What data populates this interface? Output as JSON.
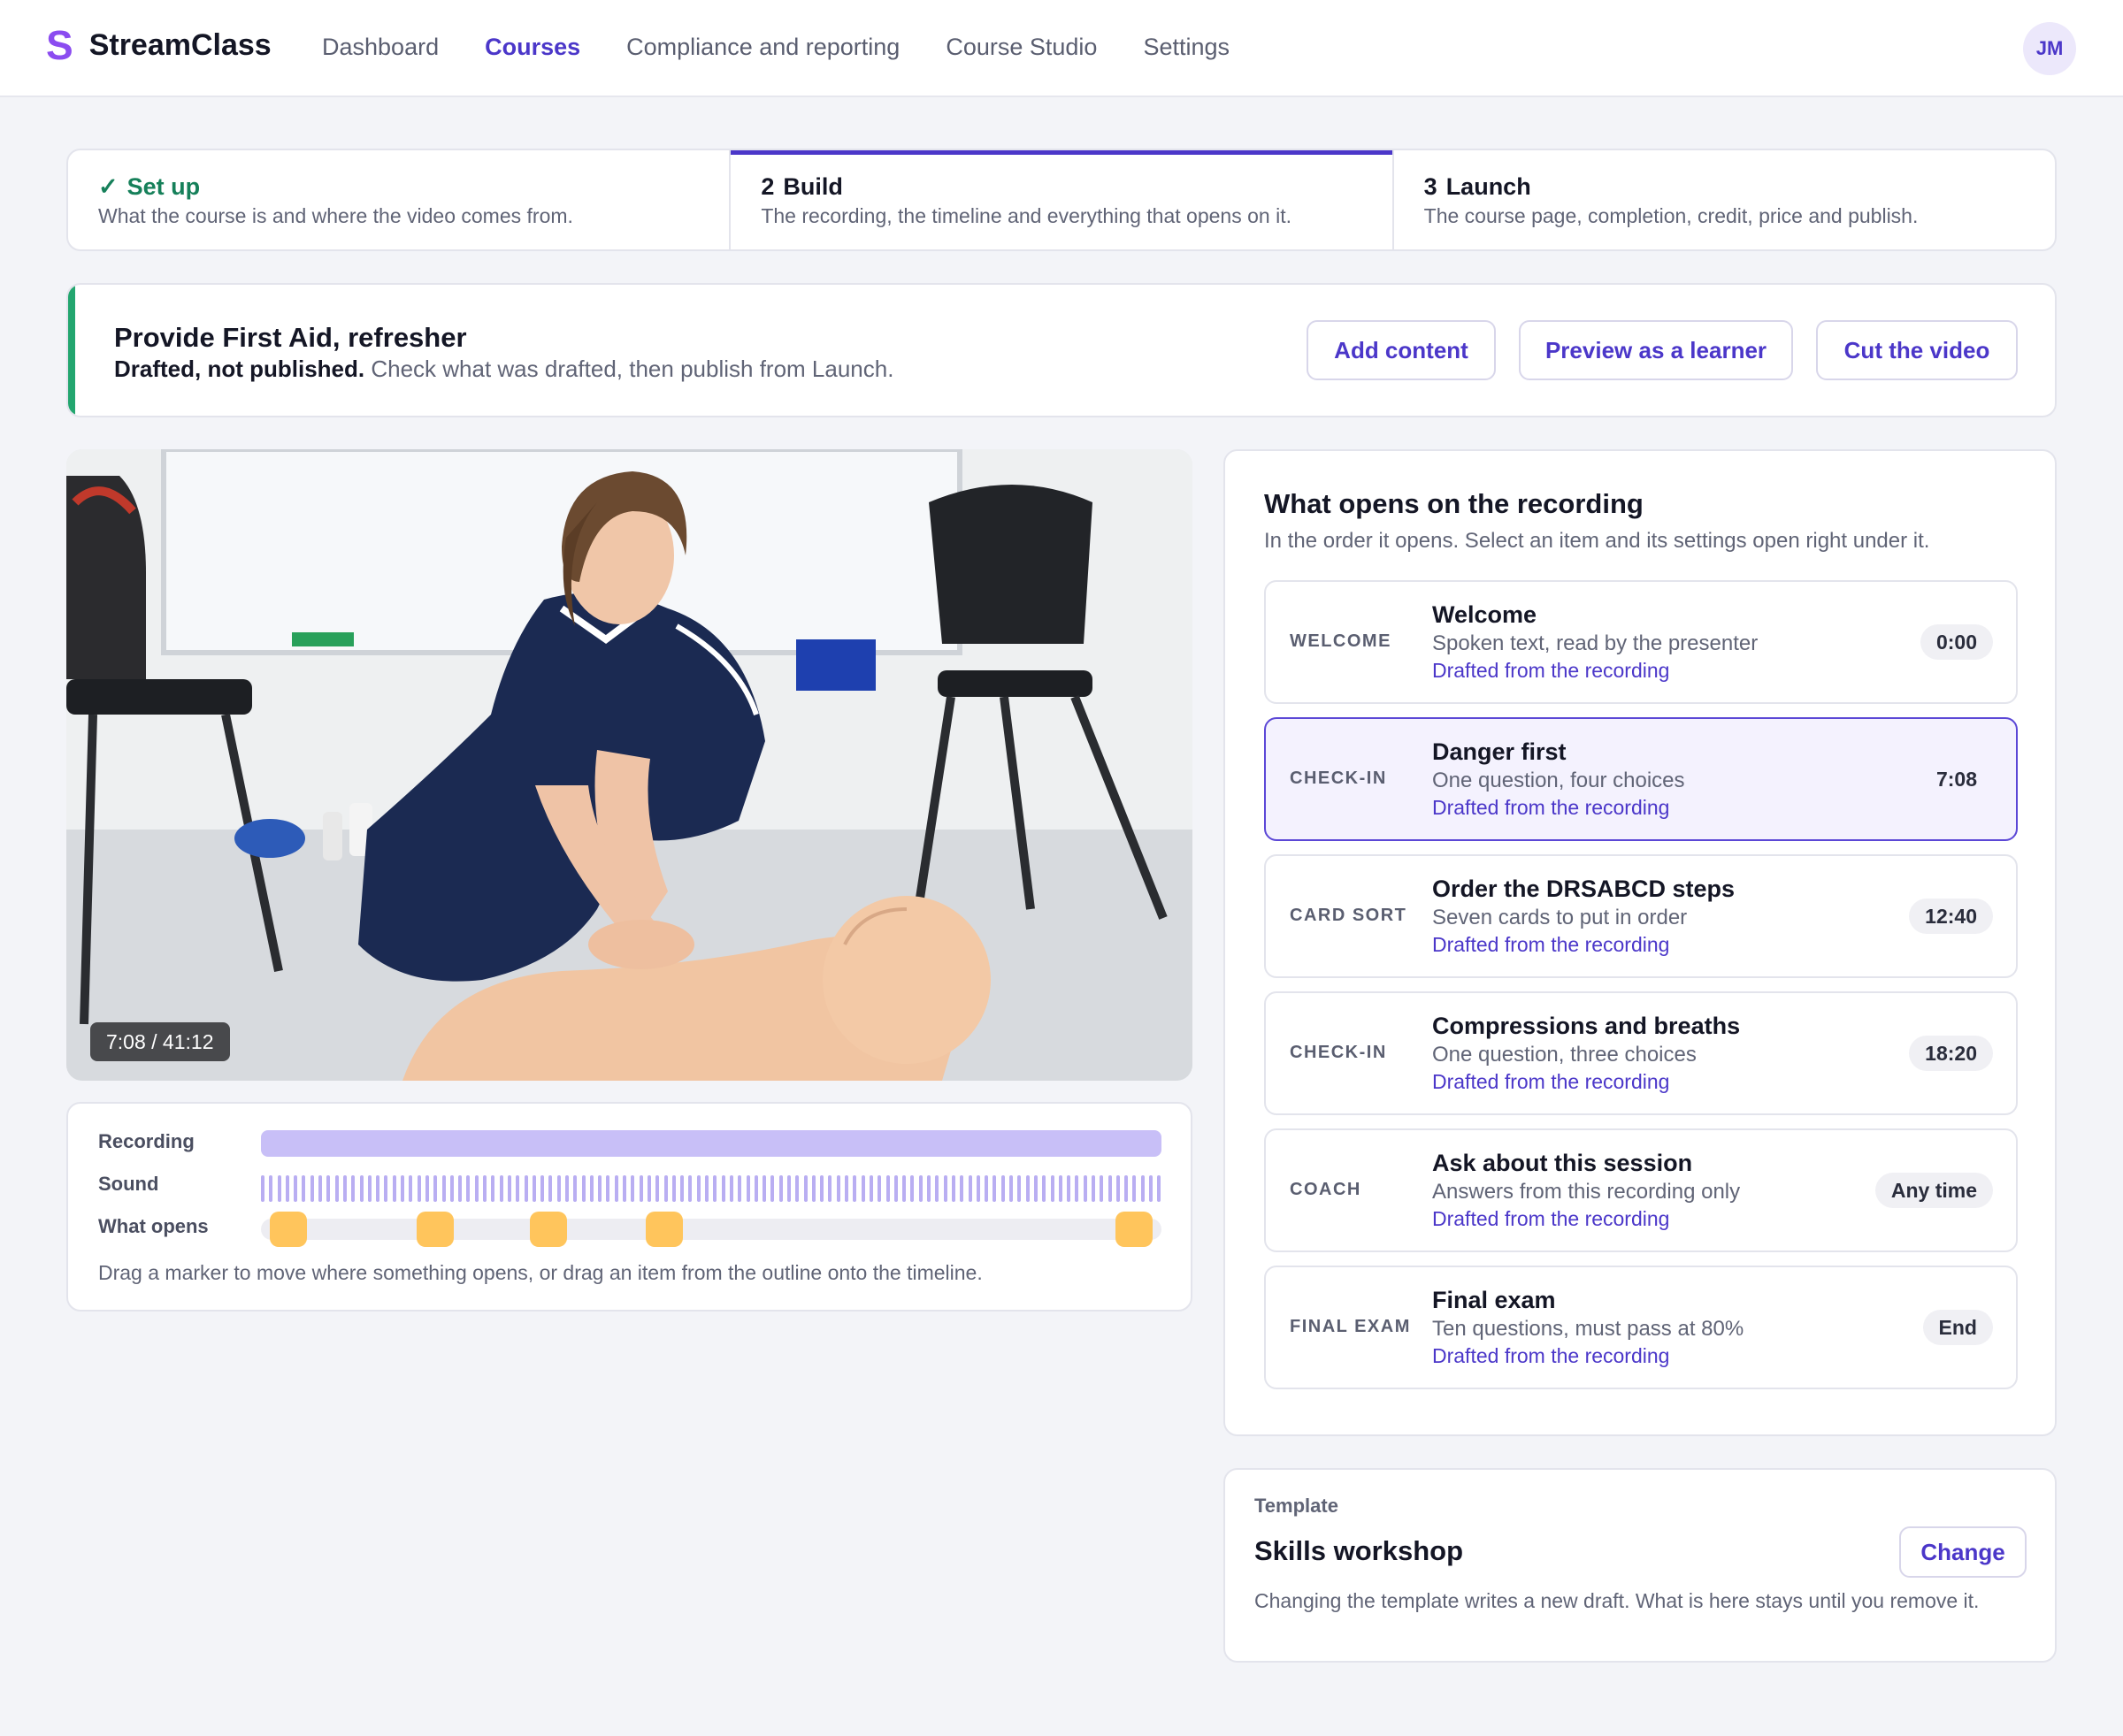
{
  "app": {
    "brand_mark": "S",
    "brand_name": "StreamClass",
    "user_initials": "JM"
  },
  "nav": {
    "items": [
      {
        "label": "Dashboard",
        "active": false
      },
      {
        "label": "Courses",
        "active": true
      },
      {
        "label": "Compliance and reporting",
        "active": false
      },
      {
        "label": "Course Studio",
        "active": false
      },
      {
        "label": "Settings",
        "active": false
      }
    ]
  },
  "stepper": {
    "steps": [
      {
        "marker": "✓",
        "name": "Set up",
        "description": "What the course is and where the video comes from.",
        "state": "done"
      },
      {
        "marker": "2",
        "name": "Build",
        "description": "The recording, the timeline and everything that opens on it.",
        "state": "current"
      },
      {
        "marker": "3",
        "name": "Launch",
        "description": "The course page, completion, credit, price and publish.",
        "state": "upcoming"
      }
    ]
  },
  "banner": {
    "title": "Provide First Aid, refresher",
    "status_bold": "Drafted, not published.",
    "status_rest": " Check what was drafted, then publish from Launch.",
    "buttons": {
      "add_content": "Add content",
      "preview": "Preview as a learner",
      "cut_video": "Cut the video"
    }
  },
  "video": {
    "timecode": "7:08 / 41:12",
    "current_seconds": 428,
    "duration_seconds": 2472
  },
  "timeline": {
    "labels": {
      "recording": "Recording",
      "sound": "Sound",
      "what_opens": "What opens"
    },
    "hint": "Drag a marker to move where something opens, or drag an item from the outline onto the timeline.",
    "duration_seconds": 2472,
    "marker_seconds": [
      0,
      428,
      760,
      1100,
      2472
    ]
  },
  "outline": {
    "title": "What opens on the recording",
    "subtitle": "In the order it opens. Select an item and its settings open right under it.",
    "items": [
      {
        "kind": "WELCOME",
        "title": "Welcome",
        "description": "Spoken text, read by the presenter",
        "source": "Drafted from the recording",
        "time": "0:00",
        "selected": false
      },
      {
        "kind": "CHECK-IN",
        "title": "Danger first",
        "description": "One question, four choices",
        "source": "Drafted from the recording",
        "time": "7:08",
        "selected": true
      },
      {
        "kind": "CARD SORT",
        "title": "Order the DRSABCD steps",
        "description": "Seven cards to put in order",
        "source": "Drafted from the recording",
        "time": "12:40",
        "selected": false
      },
      {
        "kind": "CHECK-IN",
        "title": "Compressions and breaths",
        "description": "One question, three choices",
        "source": "Drafted from the recording",
        "time": "18:20",
        "selected": false
      },
      {
        "kind": "COACH",
        "title": "Ask about this session",
        "description": "Answers from this recording only",
        "source": "Drafted from the recording",
        "time": "Any time",
        "selected": false
      },
      {
        "kind": "FINAL EXAM",
        "title": "Final exam",
        "description": "Ten questions, must pass at 80%",
        "source": "Drafted from the recording",
        "time": "End",
        "selected": false
      }
    ]
  },
  "template": {
    "label": "Template",
    "name": "Skills workshop",
    "change_label": "Change",
    "description": "Changing the template writes a new draft. What is here stays until you remove it."
  },
  "colors": {
    "accent": "#4b37c9",
    "brand": "#8b4cf0",
    "success": "#16805a",
    "banner_stripe": "#23a66f",
    "marker": "#ffc55c",
    "recording_bar": "#c8bff7"
  }
}
